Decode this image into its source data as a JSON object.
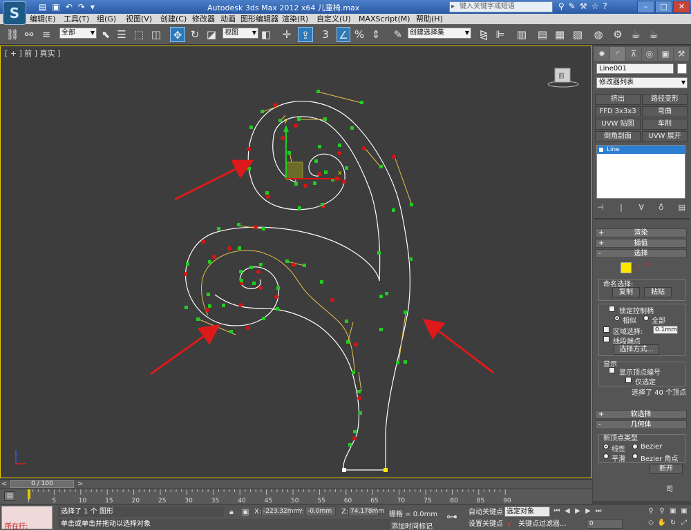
{
  "titlebar": {
    "app_logo": "S",
    "window_title": "Autodesk 3ds Max  2012 x64       儿童椅.max",
    "search_placeholder": "键入关键字或短语",
    "qat_icons": [
      "open-icon",
      "save-icon",
      "undo-icon",
      "redo-icon",
      "dropdown-icon"
    ]
  },
  "menu": [
    {
      "label": "编辑(E)"
    },
    {
      "label": "工具(T)"
    },
    {
      "label": "组(G)"
    },
    {
      "label": "视图(V)"
    },
    {
      "label": "创建(C)"
    },
    {
      "label": "修改器"
    },
    {
      "label": "动画"
    },
    {
      "label": "图形编辑器"
    },
    {
      "label": "渲染(R)"
    },
    {
      "label": "自定义(U)"
    },
    {
      "label": "MAXScript(M)"
    },
    {
      "label": "帮助(H)"
    }
  ],
  "toolbar": {
    "selection_filter": "全部",
    "ref_coord": "视图",
    "named_selection": "创建选择集"
  },
  "viewport": {
    "label": "[ + ] 前 ] 真实 ]",
    "viewcube_label": "前",
    "axis_x": "x",
    "axis_y": "y"
  },
  "cmdpanel": {
    "object_name": "Line001",
    "modifier_list": "修改器列表",
    "modifier_buttons": [
      {
        "label": "挤出"
      },
      {
        "label": "路径变形"
      },
      {
        "label": "FFD 3x3x3"
      },
      {
        "label": "弯曲"
      },
      {
        "label": "UVW 贴图"
      },
      {
        "label": "车削"
      },
      {
        "label": "倒角剖面"
      },
      {
        "label": "UVW 展开"
      }
    ],
    "stack_item": "Line",
    "rollouts": {
      "render": "渲染",
      "interp": "插值",
      "selection": "选择",
      "soft_selection": "软选择",
      "geometry": "几何体"
    },
    "selection": {
      "named_selection_label": "命名选择:",
      "copy": "复制",
      "paste": "粘贴",
      "lock_handles": "锁定控制柄",
      "alike": "相似",
      "all": "全部",
      "area_select": "区域选择:",
      "area_value": "0.1mm",
      "segment_end": "线段端点",
      "select_by": "选择方式...",
      "display_label": "显示",
      "show_vertex_numbers": "显示顶点编号",
      "selected_only": "仅选定",
      "selected_count": "选择了 40 个顶点"
    },
    "geometry": {
      "new_vertex_type": "新顶点类型",
      "linear": "线性",
      "bezier": "Bezier",
      "smooth": "平滑",
      "bezier_corner": "Bezier 角点",
      "break": "断开",
      "sub_label": "司"
    }
  },
  "timeslider": {
    "frame_display": "0 / 100",
    "left_arrow": "<",
    "right_arrow": ">"
  },
  "trackbar": {
    "ticks": [
      "0",
      "5",
      "10",
      "15",
      "20",
      "25",
      "30",
      "35",
      "40",
      "45",
      "50",
      "55",
      "60",
      "65",
      "70",
      "75",
      "80",
      "85",
      "90"
    ]
  },
  "statusbar": {
    "running_label": "所在行:",
    "status1": "选择了 1 个 图形",
    "status2": "单击或单击并拖动以选择对象",
    "x_label": "X:",
    "x_value": "-223.32mm",
    "y_label": "Y:",
    "y_value": "-0.0mm",
    "z_label": "Z:",
    "z_value": "74.178mm",
    "grid": "栅格 = 0.0mm",
    "auto_key": "自动关键点",
    "set_key": "设置关键点",
    "selected_object": "选定对象",
    "key_filters": "关键点过滤器...",
    "add_time_tag": "添加时间标记",
    "frame": "0"
  },
  "colors": {
    "viewport_bg": "#3d3d3d",
    "viewport_border": "#e3c800",
    "spline": "#ffffff",
    "vertex_green": "#22cc22",
    "vertex_red": "#dd1111",
    "arrow": "#dd1a1a",
    "titlebar": "#2b5aa5"
  }
}
